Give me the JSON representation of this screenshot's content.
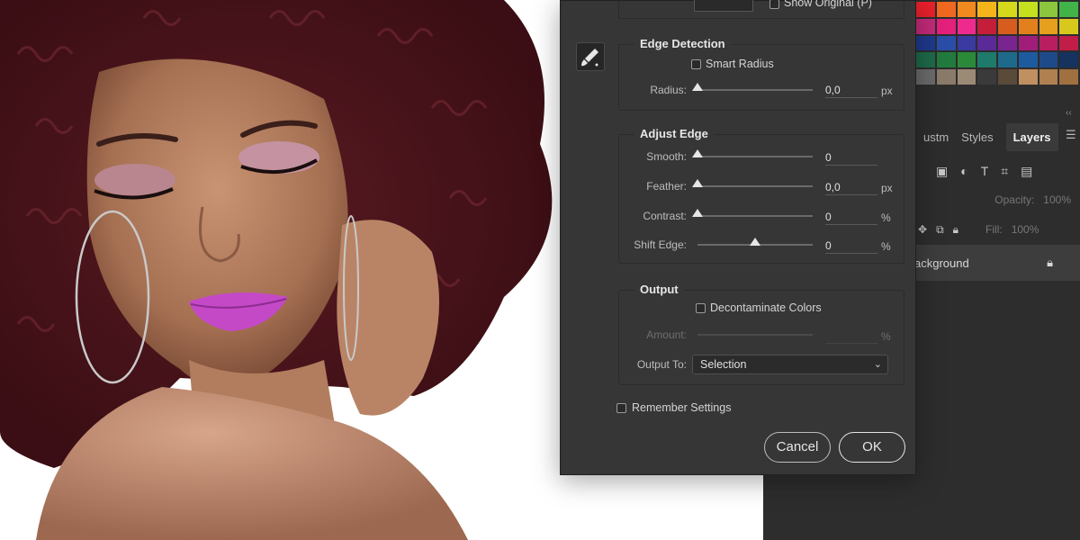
{
  "photo": {
    "description_icon": "portrait-photo"
  },
  "top_section": {
    "show_original_label": "Show Original (P)"
  },
  "edge_detection": {
    "title": "Edge Detection",
    "smart_radius_label": "Smart Radius",
    "radius": {
      "label": "Radius:",
      "value": "0,0",
      "unit": "px",
      "level": 0.0
    }
  },
  "adjust_edge": {
    "title": "Adjust Edge",
    "smooth": {
      "label": "Smooth:",
      "value": "0",
      "unit": "",
      "level": 0.0
    },
    "feather": {
      "label": "Feather:",
      "value": "0,0",
      "unit": "px",
      "level": 0.0
    },
    "contrast": {
      "label": "Contrast:",
      "value": "0",
      "unit": "%",
      "level": 0.0
    },
    "shift_edge": {
      "label": "Shift Edge:",
      "value": "0",
      "unit": "%",
      "level": 0.5
    }
  },
  "output": {
    "title": "Output",
    "decontaminate_label": "Decontaminate Colors",
    "amount": {
      "label": "Amount:",
      "value": "",
      "unit": "%"
    },
    "output_to": {
      "label": "Output To:",
      "selected": "Selection"
    }
  },
  "remember_settings_label": "Remember Settings",
  "buttons": {
    "cancel": "Cancel",
    "ok": "OK"
  },
  "layers_panel": {
    "tabs": [
      "ustm",
      "Styles",
      "Layers"
    ],
    "active_tab": "Layers",
    "opacity_label": "Opacity:",
    "opacity_value": "100%",
    "fill_label": "Fill:",
    "fill_value": "100%",
    "layer_name": "ackground"
  },
  "colors": {
    "dialog_bg": "#363636",
    "panel_bg": "#2d2d2d",
    "swatches": [
      "#e8202a",
      "#ee6820",
      "#f08a1e",
      "#f4b41a",
      "#d6d81c",
      "#c4e01e",
      "#8cc63e",
      "#42b348",
      "#c32a7a",
      "#e3207c",
      "#ee2a8e",
      "#c41e3a",
      "#d65d1e",
      "#e2801e",
      "#e6a01e",
      "#d8c81e",
      "#1e3a8c",
      "#2a4ea8",
      "#3a3aa0",
      "#5a2a98",
      "#7a2490",
      "#a01e7a",
      "#b81e60",
      "#c01e48",
      "#1e6a4a",
      "#227a3e",
      "#2a8a3a",
      "#1e7a6a",
      "#1e6a8a",
      "#1e5a9e",
      "#1e4a8a",
      "#16325e",
      "#6a6a6a",
      "#8a7a6a",
      "#9a8a76",
      "#3a3a3a",
      "#5a4a3a",
      "#c09060",
      "#b08050",
      "#a07040"
    ]
  }
}
